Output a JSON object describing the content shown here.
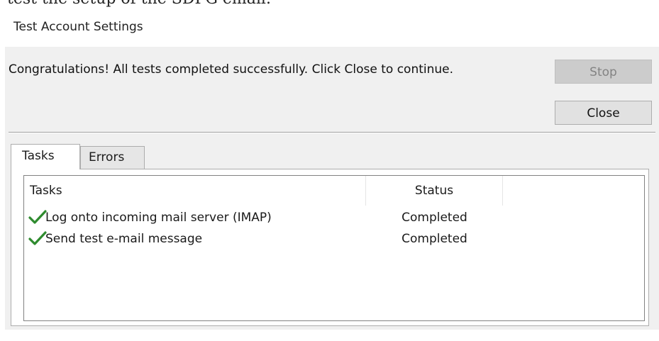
{
  "page": {
    "cropped_top_text": "test the setup of the SDPG email."
  },
  "dialog": {
    "title": "Test Account Settings",
    "message": "Congratulations! All tests completed successfully. Click Close to continue.",
    "buttons": {
      "stop_label": "Stop",
      "close_label": "Close"
    },
    "tabs": [
      {
        "label": "Tasks",
        "active": true
      },
      {
        "label": "Errors",
        "active": false
      }
    ],
    "table": {
      "columns": [
        "Tasks",
        "Status"
      ],
      "rows": [
        {
          "icon": "checkmark-icon",
          "task": "Log onto incoming mail server (IMAP)",
          "status": "Completed"
        },
        {
          "icon": "checkmark-icon",
          "task": "Send test e-mail message",
          "status": "Completed"
        }
      ]
    },
    "colors": {
      "check": "#2e8b2e",
      "dialog_bg": "#f0f0f0"
    }
  }
}
